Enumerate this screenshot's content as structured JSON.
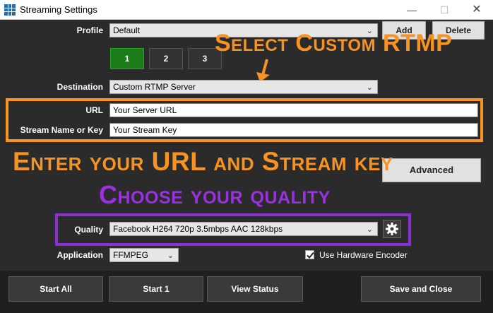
{
  "window": {
    "title": "Streaming Settings",
    "minimize_glyph": "—",
    "maximize_glyph": "☐",
    "close_glyph": "✕"
  },
  "profile": {
    "label": "Profile",
    "value": "Default",
    "add_label": "Add",
    "delete_label": "Delete"
  },
  "tabs": [
    {
      "label": "1",
      "active": true
    },
    {
      "label": "2",
      "active": false
    },
    {
      "label": "3",
      "active": false
    }
  ],
  "destination": {
    "label": "Destination",
    "value": "Custom RTMP Server"
  },
  "url": {
    "label": "URL",
    "value": "Your Server URL"
  },
  "stream_key": {
    "label": "Stream Name or Key",
    "value": "Your Stream Key"
  },
  "advanced_label": "Advanced",
  "quality": {
    "label": "Quality",
    "value": "Facebook H264 720p 3.5mbps AAC 128kbps"
  },
  "application": {
    "label": "Application",
    "value": "FFMPEG"
  },
  "hardware_encoder": {
    "label": "Use Hardware Encoder",
    "checked": true
  },
  "bottom_buttons": {
    "start_all": "Start All",
    "start_1": "Start 1",
    "view_status": "View Status",
    "save_close": "Save and Close"
  },
  "annotations": {
    "select_custom": "Select Custom RTMP",
    "enter_url": "Enter your URL and Stream key",
    "choose_quality": "Choose your quality"
  },
  "colors": {
    "orange": "#f7931e",
    "purple": "#8b2fd1",
    "active_tab": "#1a7d1a"
  }
}
